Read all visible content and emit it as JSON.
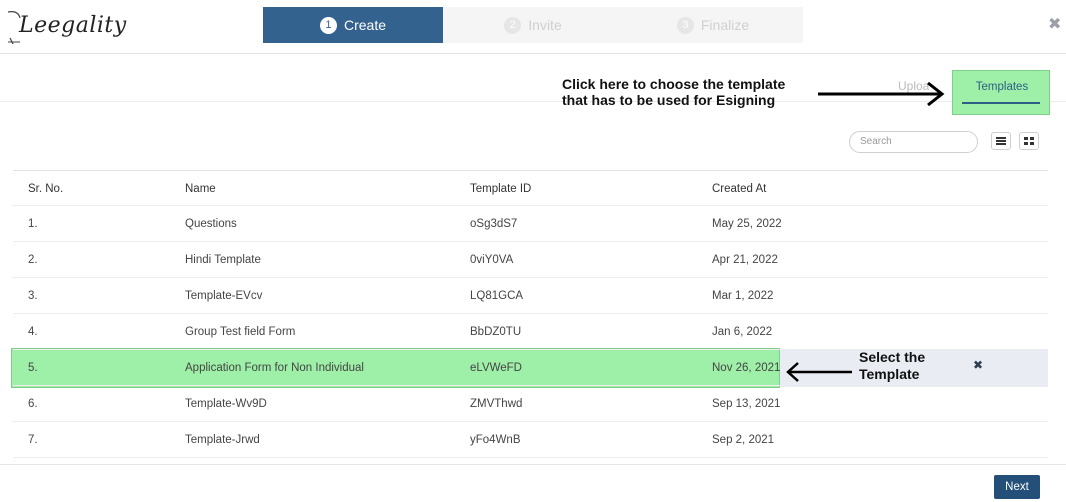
{
  "app": {
    "logo_text": "Leegality"
  },
  "steps": [
    {
      "number": "1",
      "label": "Create",
      "state": "active"
    },
    {
      "number": "2",
      "label": "Invite",
      "state": "inactive"
    },
    {
      "number": "3",
      "label": "Finalize",
      "state": "inactive"
    }
  ],
  "tabs": {
    "upload": "Uploa",
    "templates": "Templates"
  },
  "annotations": {
    "templates_hint": "Click here to choose the template that has to be used for Esigning",
    "select_hint_line1": "Select the",
    "select_hint_line2": "Template"
  },
  "search": {
    "placeholder": "Search"
  },
  "table": {
    "headers": [
      "Sr. No.",
      "Name",
      "Template ID",
      "Created At"
    ],
    "rows": [
      {
        "sr": "1.",
        "name": "Questions",
        "id": "oSg3dS7",
        "created": "May 25, 2022"
      },
      {
        "sr": "2.",
        "name": "Hindi Template",
        "id": "0viY0VA",
        "created": "Apr 21, 2022"
      },
      {
        "sr": "3.",
        "name": "Template-EVcv",
        "id": "LQ81GCA",
        "created": "Mar 1, 2022"
      },
      {
        "sr": "4.",
        "name": "Group Test field Form",
        "id": "BbDZ0TU",
        "created": "Jan 6, 2022"
      },
      {
        "sr": "5.",
        "name": "Application Form for Non Individual",
        "id": "eLVWeFD",
        "created": "Nov 26, 2021"
      },
      {
        "sr": "6.",
        "name": "Template-Wv9D",
        "id": "ZMVThwd",
        "created": "Sep 13, 2021"
      },
      {
        "sr": "7.",
        "name": "Template-Jrwd",
        "id": "yFo4WnB",
        "created": "Sep 2, 2021"
      }
    ],
    "selected_index": 4
  },
  "footer": {
    "next_label": "Next"
  },
  "colors": {
    "primary": "#34628f",
    "highlight": "#9ef0a8",
    "next": "#234f78"
  }
}
